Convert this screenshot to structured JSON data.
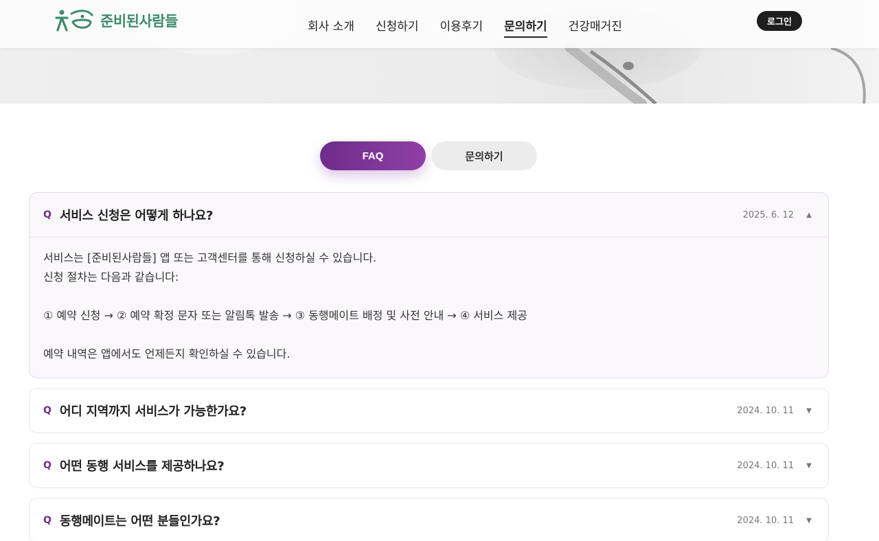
{
  "header": {
    "logo_text": "준비된사람들",
    "nav": [
      "회사 소개",
      "신청하기",
      "이용후기",
      "문의하기",
      "건강매거진"
    ],
    "active_nav": "문의하기",
    "login_label": "로그인"
  },
  "tabs": {
    "faq_label": "FAQ",
    "inquiry_label": "문의하기",
    "active": "FAQ"
  },
  "faq": [
    {
      "q_mark": "Q",
      "question": "서비스 신청은 어떻게 하나요?",
      "date": "2025. 6. 12",
      "expanded": true,
      "arrow": "▲",
      "answer_lines": [
        "서비스는 [준비된사람들] 앱 또는 고객센터를 통해 신청하실 수 있습니다.",
        "신청 절차는 다음과 같습니다:",
        "",
        "① 예약 신청 → ② 예약 확정 문자 또는 알림톡 발송 → ③ 동행메이트 배정 및 사전 안내 → ④ 서비스 제공",
        "",
        "예약 내역은 앱에서도 언제든지 확인하실 수 있습니다."
      ]
    },
    {
      "q_mark": "Q",
      "question": "어디 지역까지 서비스가 가능한가요?",
      "date": "2024. 10. 11",
      "expanded": false,
      "arrow": "▼"
    },
    {
      "q_mark": "Q",
      "question": "어떤 동행 서비스를 제공하나요?",
      "date": "2024. 10. 11",
      "expanded": false,
      "arrow": "▼"
    },
    {
      "q_mark": "Q",
      "question": "동행메이트는 어떤 분들인가요?",
      "date": "2024. 10. 11",
      "expanded": false,
      "arrow": "▼"
    }
  ],
  "colors": {
    "brand_green": "#3e8a6b",
    "accent_purple": "#7a339a",
    "login_bg": "#1e1e1e"
  }
}
